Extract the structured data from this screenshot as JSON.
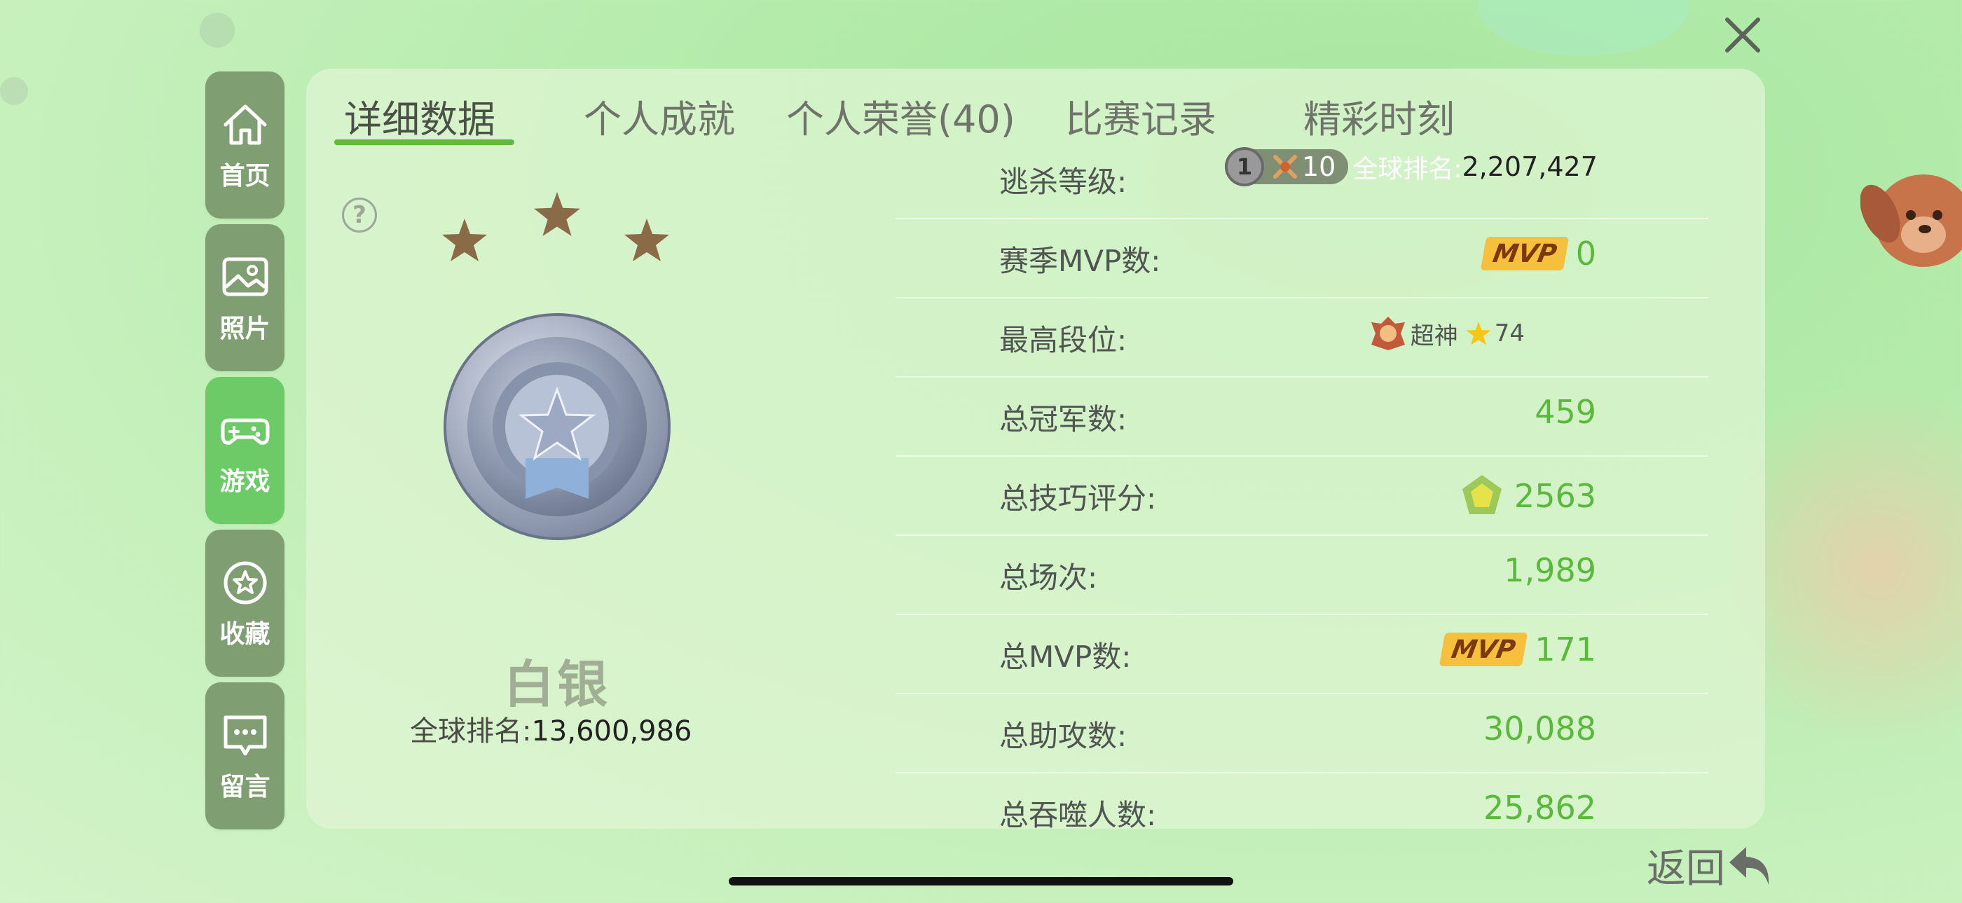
{
  "close_icon": "close-icon",
  "sidebar": {
    "items": [
      {
        "label": "首页",
        "icon": "home-icon",
        "active": false
      },
      {
        "label": "照片",
        "icon": "photo-icon",
        "active": false
      },
      {
        "label": "游戏",
        "icon": "gamepad-icon",
        "active": true
      },
      {
        "label": "收藏",
        "icon": "star-icon",
        "active": false
      },
      {
        "label": "留言",
        "icon": "message-icon",
        "active": false
      }
    ]
  },
  "tabs": [
    "详细数据",
    "个人成就",
    "个人荣誉(40)",
    "比赛记录",
    "精彩时刻"
  ],
  "active_tab": "详细数据",
  "rank_card": {
    "help": "?",
    "rank_name": "白银",
    "global_rank_label": "全球排名:",
    "global_rank_value": "13,600,986"
  },
  "stats": {
    "escape_level": {
      "label": "逃杀等级:",
      "badge_num": "1",
      "level": "10",
      "rank_label": "全球排名:",
      "rank_value": "2,207,427"
    },
    "season_mvp": {
      "label": "赛季MVP数:",
      "badge": "MVP",
      "value": "0"
    },
    "highest_tier": {
      "label": "最高段位:",
      "tier": "超神",
      "stars": "74"
    },
    "total_championships": {
      "label": "总冠军数:",
      "value": "459"
    },
    "total_skill": {
      "label": "总技巧评分:",
      "value": "2563"
    },
    "total_games": {
      "label": "总场次:",
      "value": "1,989"
    },
    "total_mvp": {
      "label": "总MVP数:",
      "badge": "MVP",
      "value": "171"
    },
    "total_assists": {
      "label": "总助攻数:",
      "value": "30,088"
    },
    "total_devoured": {
      "label": "总吞噬人数:",
      "value": "25,862"
    }
  },
  "back_label": "返回",
  "colors": {
    "accent_green": "#5fbb3e",
    "sidebar": "#7f9f72",
    "sidebar_active": "#6ccb66",
    "mvp_badge": "#f6bf3c"
  }
}
